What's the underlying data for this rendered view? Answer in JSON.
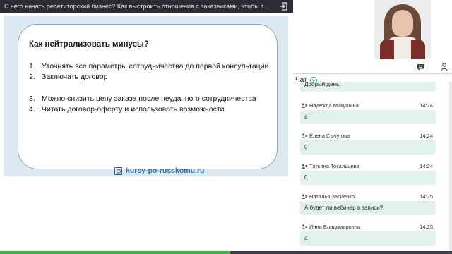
{
  "window": {
    "title": "С чего начать репетиторский бизнес? Как выстроить отношения с заказчиками, чтобы зара..."
  },
  "slide": {
    "heading": "Как нейтрализовать минусы?",
    "items": [
      {
        "num": "1.",
        "text": "Уточнять все параметры сотрудничества до первой консультации"
      },
      {
        "num": "2.",
        "text": "Заключать договор"
      },
      {
        "num": "3.",
        "text": "Можно снизить цену заказа после неудачного сотрудничества"
      },
      {
        "num": "4.",
        "text": "Читать договор-оферту и использовать возможности"
      }
    ],
    "site": "kursy-po-russkomu.ru"
  },
  "chat": {
    "title": "Чат",
    "first_message": "Добрый день!",
    "messages": [
      {
        "name": "Надежда Микушина",
        "time": "14:24",
        "text": "а"
      },
      {
        "name": "Елена Сычугова",
        "time": "14:24",
        "text": "0"
      },
      {
        "name": "Татьяна Токальцева",
        "time": "14:24",
        "text": "0"
      },
      {
        "name": "Наталья Засиенко",
        "time": "14:25",
        "text": "А будет ли вебинар в записи?"
      },
      {
        "name": "Инна Владимировна",
        "time": "14:25",
        "text": "а"
      }
    ]
  },
  "colors": {
    "accent": "#39b54a",
    "bubble": "#e1f2ec",
    "link": "#2d6fae"
  },
  "video": {
    "progress": 0.51
  }
}
